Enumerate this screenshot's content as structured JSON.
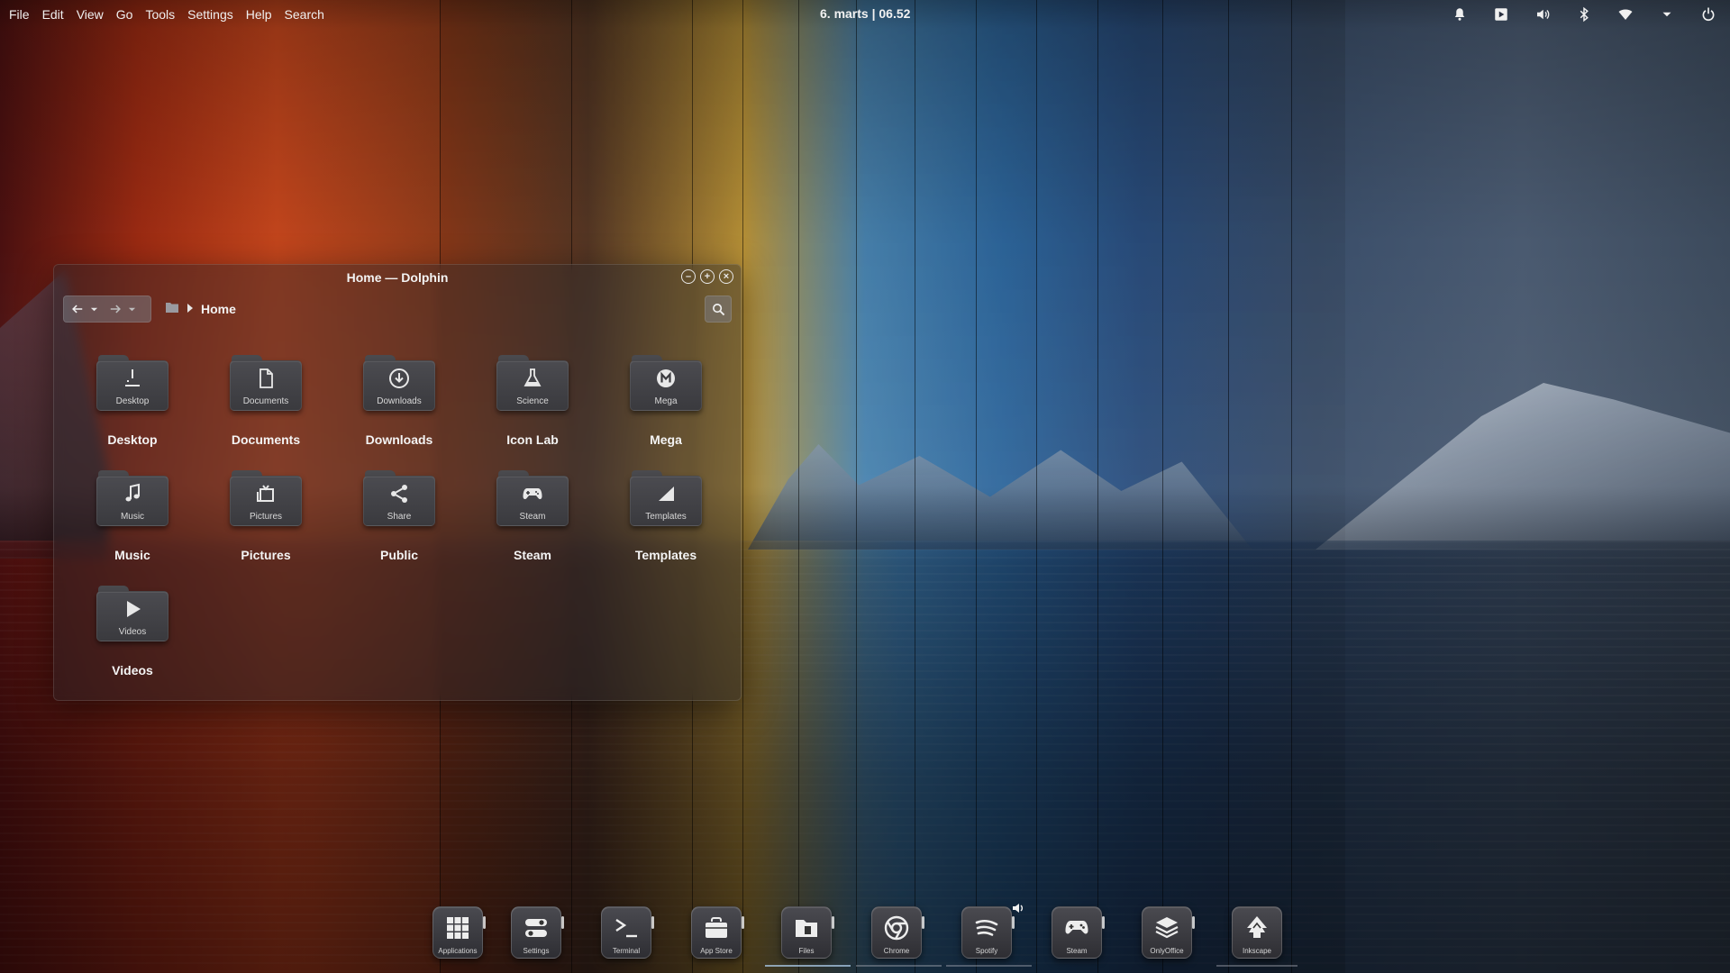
{
  "topbar": {
    "menu": [
      "File",
      "Edit",
      "View",
      "Go",
      "Tools",
      "Settings",
      "Help",
      "Search"
    ],
    "clock": "6. marts | 06.52",
    "tray_icons": [
      "notification-bell-icon",
      "media-player-icon",
      "volume-icon",
      "bluetooth-icon",
      "wifi-icon",
      "tray-expand-icon",
      "power-icon"
    ]
  },
  "window": {
    "title": "Home — Dolphin",
    "breadcrumb": {
      "current": "Home"
    },
    "folders": [
      {
        "label": "Desktop",
        "sub": "Desktop",
        "icon": "desktop-icon"
      },
      {
        "label": "Documents",
        "sub": "Documents",
        "icon": "document-icon"
      },
      {
        "label": "Downloads",
        "sub": "Downloads",
        "icon": "download-icon"
      },
      {
        "label": "Icon Lab",
        "sub": "Science",
        "icon": "flask-icon"
      },
      {
        "label": "Mega",
        "sub": "Mega",
        "icon": "mega-icon"
      },
      {
        "label": "Music",
        "sub": "Music",
        "icon": "music-note-icon"
      },
      {
        "label": "Pictures",
        "sub": "Pictures",
        "icon": "picture-icon"
      },
      {
        "label": "Public",
        "sub": "Share",
        "icon": "share-icon"
      },
      {
        "label": "Steam",
        "sub": "Steam",
        "icon": "gamepad-icon"
      },
      {
        "label": "Templates",
        "sub": "Templates",
        "icon": "template-icon"
      },
      {
        "label": "Videos",
        "sub": "Videos",
        "icon": "play-icon"
      }
    ]
  },
  "dock": {
    "items": [
      {
        "label": "Applications",
        "icon": "app-grid-icon",
        "running": true
      },
      {
        "label": "Settings",
        "icon": "toggle-settings-icon",
        "running": true
      },
      {
        "label": "Terminal",
        "icon": "terminal-icon",
        "running": true
      },
      {
        "label": "App Store",
        "icon": "store-bag-icon",
        "running": true
      },
      {
        "label": "Files",
        "icon": "files-folder-icon",
        "running": true,
        "active": true
      },
      {
        "label": "Chrome",
        "icon": "chrome-icon",
        "running": true
      },
      {
        "label": "Spotify",
        "icon": "spotify-icon",
        "running": true
      },
      {
        "label": "Steam",
        "icon": "steam-gamepad-icon",
        "running": true
      },
      {
        "label": "OnlyOffice",
        "icon": "layers-icon",
        "running": true
      },
      {
        "label": "Inkscape",
        "icon": "inkscape-icon",
        "running": false
      }
    ]
  }
}
